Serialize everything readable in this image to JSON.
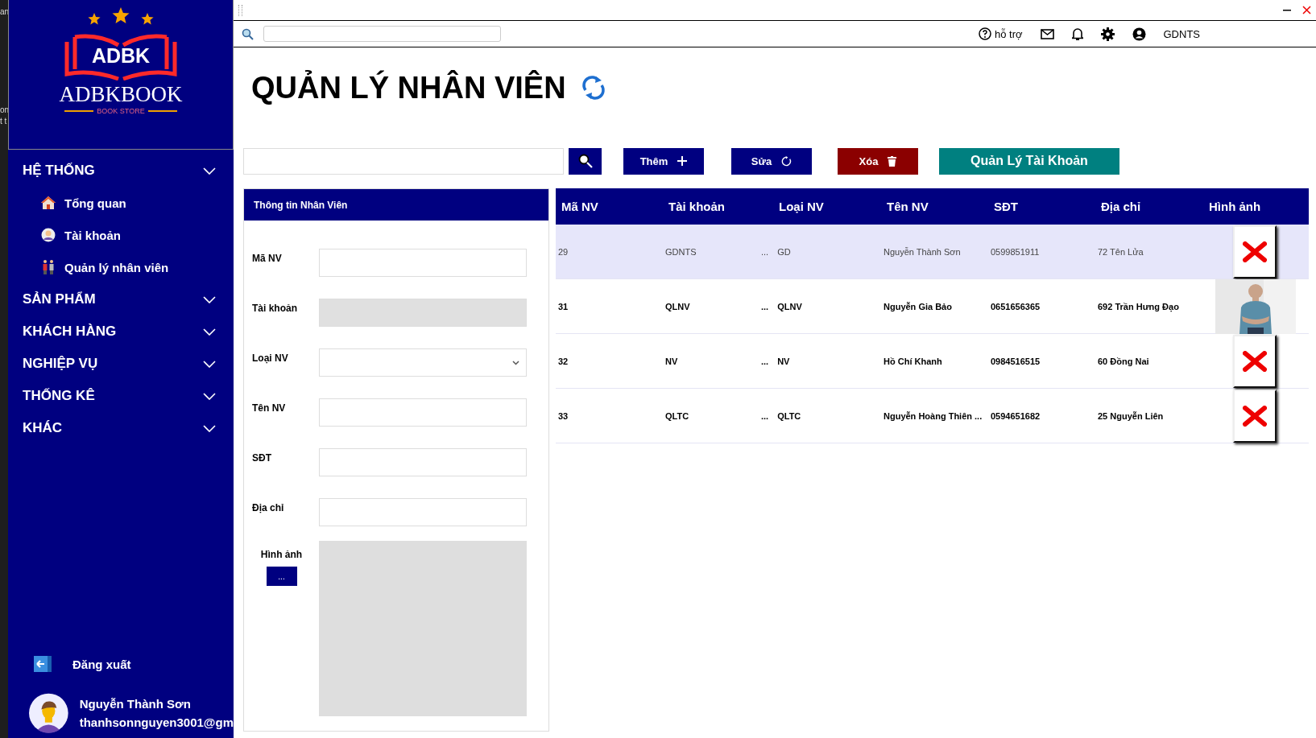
{
  "side_strip": [
    "an",
    "on",
    "t t"
  ],
  "logo": {
    "mark": "ADBK",
    "name": "ADBKBOOK",
    "tagline": "BOOK STORE"
  },
  "nav": [
    {
      "label": "HỆ THỐNG",
      "children": [
        {
          "label": "Tổng quan"
        },
        {
          "label": "Tài khoản"
        },
        {
          "label": "Quản lý nhân viên"
        }
      ]
    },
    {
      "label": "SẢN PHẨM"
    },
    {
      "label": "KHÁCH HÀNG"
    },
    {
      "label": "NGHIỆP VỤ"
    },
    {
      "label": "THỐNG KÊ"
    },
    {
      "label": "KHÁC"
    }
  ],
  "logout": "Đăng xuất",
  "user": {
    "name": "Nguyễn Thành Sơn",
    "email": "thanhsonnguyen3001@gm"
  },
  "toolbar": {
    "help": "hỗ trợ",
    "user": "GDNTS"
  },
  "title": "QUẢN LÝ NHÂN VIÊN",
  "actions": [
    {
      "label": "Thêm",
      "kind": "add"
    },
    {
      "label": "Sửa",
      "kind": "edit"
    },
    {
      "label": "Xóa",
      "kind": "delete"
    },
    {
      "label": "Quản Lý Tài Khoản",
      "kind": "accounts"
    }
  ],
  "form": {
    "title": "Thông tin Nhân Viên",
    "fields": [
      {
        "label": "Mã NV",
        "kind": "text"
      },
      {
        "label": "Tài khoản",
        "kind": "readonly"
      },
      {
        "label": "Loại NV",
        "kind": "select"
      },
      {
        "label": "Tên NV",
        "kind": "text"
      },
      {
        "label": "SĐT",
        "kind": "text"
      },
      {
        "label": "Địa chỉ",
        "kind": "text"
      }
    ],
    "image_label": "Hình ảnh",
    "browse": "..."
  },
  "table": {
    "columns": [
      "Mã NV",
      "Tài khoản",
      "Loại NV",
      "Tên NV",
      "SĐT",
      "Địa chỉ",
      "Hình ảnh"
    ],
    "rows": [
      {
        "cells": [
          "29",
          "GDNTS",
          "GD",
          "Nguyễn Thành Sơn",
          "0599851911",
          "72 Tên Lửa"
        ],
        "type_prefix": "...",
        "kind": "broken",
        "selected": true
      },
      {
        "cells": [
          "31",
          "QLNV",
          "QLNV",
          "Nguyễn Gia Bảo",
          "0651656365",
          "692 Trần Hưng Đạo"
        ],
        "type_prefix": "...",
        "kind": "picture",
        "selected": false
      },
      {
        "cells": [
          "32",
          "NV",
          "NV",
          "Hồ Chí Khanh",
          "0984516515",
          "60 Đồng Nai"
        ],
        "type_prefix": "...",
        "kind": "broken",
        "selected": false
      },
      {
        "cells": [
          "33",
          "QLTC",
          "QLTC",
          "Nguyễn Hoàng Thiên ...",
          "0594651682",
          "25 Nguyễn Liên"
        ],
        "type_prefix": "...",
        "kind": "broken",
        "selected": false
      }
    ]
  }
}
